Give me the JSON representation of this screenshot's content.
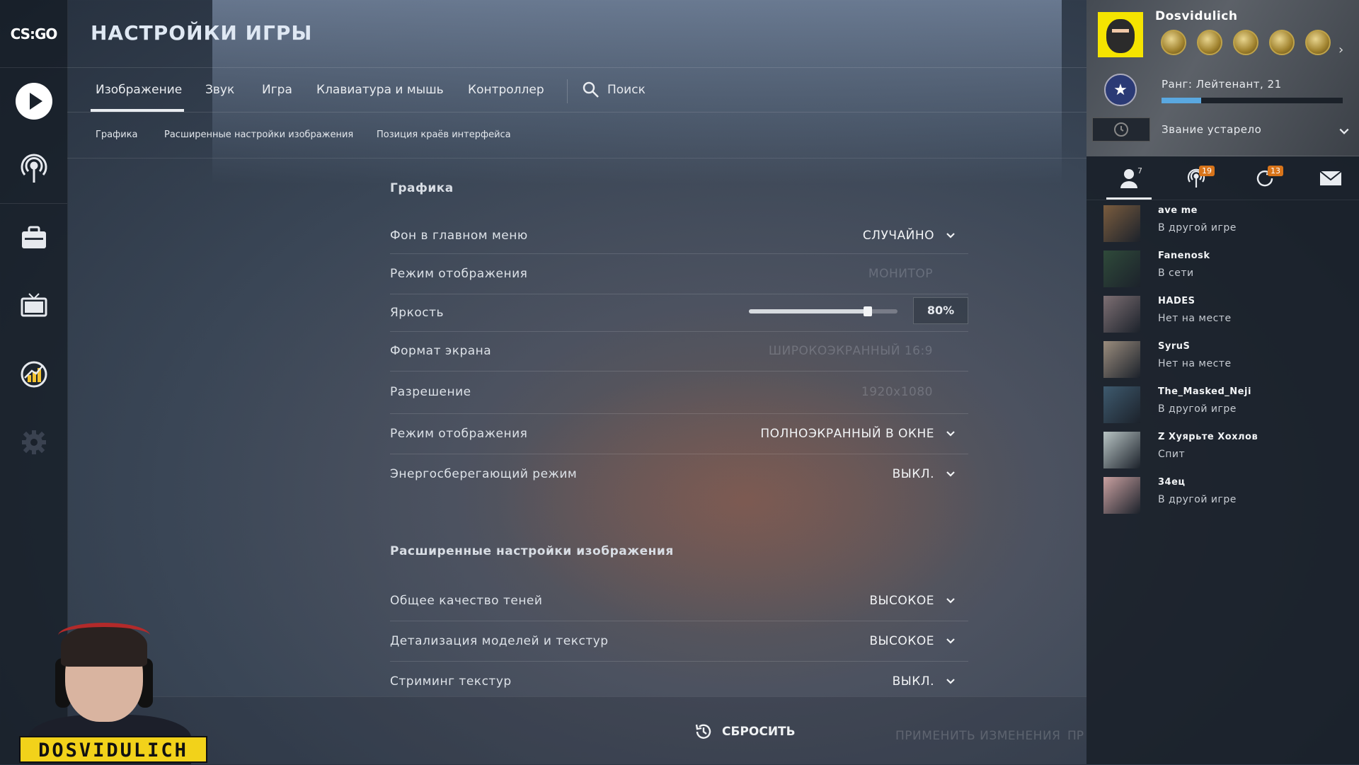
{
  "app": {
    "logo": "CS:GO"
  },
  "header": {
    "title": "НАСТРОЙКИ ИГРЫ"
  },
  "tabs": [
    {
      "label": "Изображение"
    },
    {
      "label": "Звук"
    },
    {
      "label": "Игра"
    },
    {
      "label": "Клавиатура и мышь"
    },
    {
      "label": "Контроллер"
    }
  ],
  "search": {
    "label": "Поиск"
  },
  "subtabs": [
    {
      "label": "Графика"
    },
    {
      "label": "Расширенные настройки изображения"
    },
    {
      "label": "Позиция краёв интерфейса"
    }
  ],
  "sections": {
    "graphics": "Графика",
    "advanced": "Расширенные настройки изображения"
  },
  "settings": [
    {
      "label": "Фон в главном меню",
      "value": "СЛУЧАЙНО"
    },
    {
      "label": "Режим отображения",
      "value": "МОНИТОР"
    },
    {
      "label": "Яркость",
      "value": "80%",
      "level": 0.8
    },
    {
      "label": "Формат экрана",
      "value": "ШИРОКОЭКРАННЫЙ 16:9"
    },
    {
      "label": "Разрешение",
      "value": "1920x1080"
    },
    {
      "label": "Режим отображения",
      "value": "ПОЛНОЭКРАННЫЙ В ОКНЕ"
    },
    {
      "label": "Энергосберегающий режим",
      "value": "ВЫКЛ."
    },
    {
      "label": "Общее качество теней",
      "value": "ВЫСОКОЕ"
    },
    {
      "label": "Детализация моделей и текстур",
      "value": "ВЫСОКОЕ"
    },
    {
      "label": "Стриминг текстур",
      "value": "ВЫКЛ."
    }
  ],
  "bottom": {
    "reset": "СБРОСИТЬ",
    "apply": "ПРИМЕНИТЬ ИЗМЕНЕНИЯ",
    "more": "ПР"
  },
  "webcam": {
    "nameplate": "DOSVIDULICH"
  },
  "profile": {
    "name": "Dosvidulich",
    "rank": "Ранг: Лейтенант, 21",
    "rank_progress": 0.22,
    "competitive": "Звание устарело"
  },
  "social_tabs": {
    "friends_count": "7",
    "broadcast_count": "19",
    "recent_count": "13"
  },
  "friends": [
    {
      "name": "ave me",
      "status": "В другой игре",
      "color": "#7a5c3e"
    },
    {
      "name": "Fanenosk",
      "status": "В сети",
      "color": "#2f4a3a"
    },
    {
      "name": "HADES",
      "status": "Нет на месте",
      "color": "#7d6f73"
    },
    {
      "name": "SyruS",
      "status": "Нет на месте",
      "color": "#9a8c7d"
    },
    {
      "name": "The_Masked_Neji",
      "status": "В другой игре",
      "color": "#3e5a6e"
    },
    {
      "name": "Z Хуярьте Хохлов",
      "status": "Спит",
      "color": "#b8c4c4"
    },
    {
      "name": "34ец",
      "status": "В другой игре",
      "color": "#c9a0a0"
    }
  ],
  "colors": {
    "accent": "#e9ecf0",
    "badge": "#d8741a",
    "rank_bar": "#5aa8e0",
    "nameplate": "#f2d21a"
  }
}
